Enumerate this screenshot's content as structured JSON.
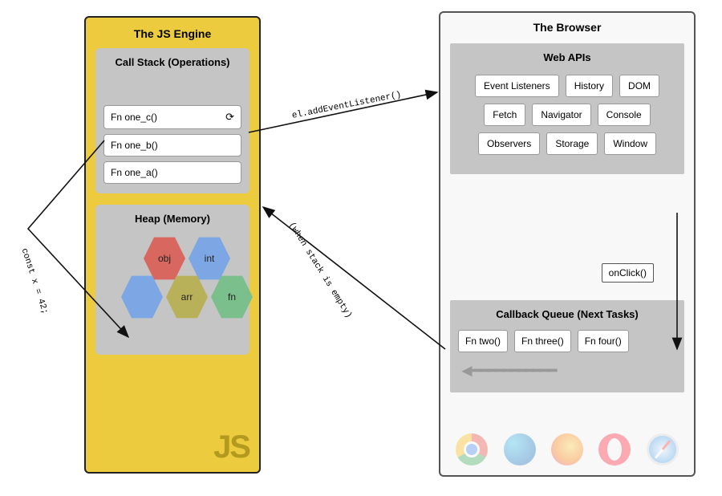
{
  "jsEngine": {
    "title": "The JS Engine",
    "callStack": {
      "title": "Call Stack (Operations)",
      "frames": [
        "Fn one_c()",
        "Fn one_b()",
        "Fn one_a()"
      ]
    },
    "heap": {
      "title": "Heap (Memory)",
      "items": [
        {
          "label": "obj",
          "color": "#d8675f"
        },
        {
          "label": "int",
          "color": "#7ca7e4"
        },
        {
          "label": "",
          "color": "#7ca7e4"
        },
        {
          "label": "arr",
          "color": "#b8b15a"
        },
        {
          "label": "fn",
          "color": "#7bbf8c"
        }
      ]
    },
    "badge": "JS"
  },
  "browser": {
    "title": "The Browser",
    "webApis": {
      "title": "Web APIs",
      "rows": [
        [
          "Event Listeners",
          "History",
          "DOM"
        ],
        [
          "Fetch",
          "Navigator",
          "Console"
        ],
        [
          "Observers",
          "Storage",
          "Window"
        ]
      ]
    },
    "onClickLabel": "onClick()",
    "callbackQueue": {
      "title": "Callback Queue (Next Tasks)",
      "items": [
        "Fn two()",
        "Fn three()",
        "Fn four()"
      ]
    }
  },
  "arrows": {
    "constX": "const x = 42;",
    "addEventListener": "el.addEventListener()",
    "whenEmpty": "(when stack is empty)"
  },
  "browserIcons": [
    "chrome",
    "edge",
    "firefox",
    "opera",
    "safari"
  ]
}
